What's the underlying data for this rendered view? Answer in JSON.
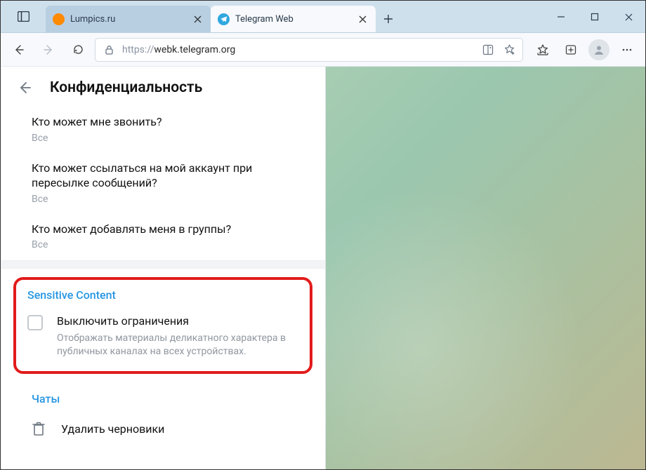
{
  "browser": {
    "tabs": [
      {
        "title": "Lumpics.ru",
        "favicon": "lumpics"
      },
      {
        "title": "Telegram Web",
        "favicon": "telegram"
      }
    ],
    "url_scheme": "https://",
    "url_host": "webk.telegram.org"
  },
  "header": {
    "title": "Конфиденциальность"
  },
  "settings": [
    {
      "title": "Кто может мне звонить?",
      "value": "Все"
    },
    {
      "title": "Кто может ссылаться на мой аккаунт при пересылке сообщений?",
      "value": "Все"
    },
    {
      "title": "Кто может добавлять меня в группы?",
      "value": "Все"
    }
  ],
  "sensitive": {
    "section_label": "Sensitive Content",
    "toggle_title": "Выключить ограничения",
    "toggle_desc": "Отображать материалы деликатного характера в публичных каналах на всех устройствах.",
    "checked": false
  },
  "chats": {
    "section_label": "Чаты",
    "delete_drafts": "Удалить черновики"
  }
}
